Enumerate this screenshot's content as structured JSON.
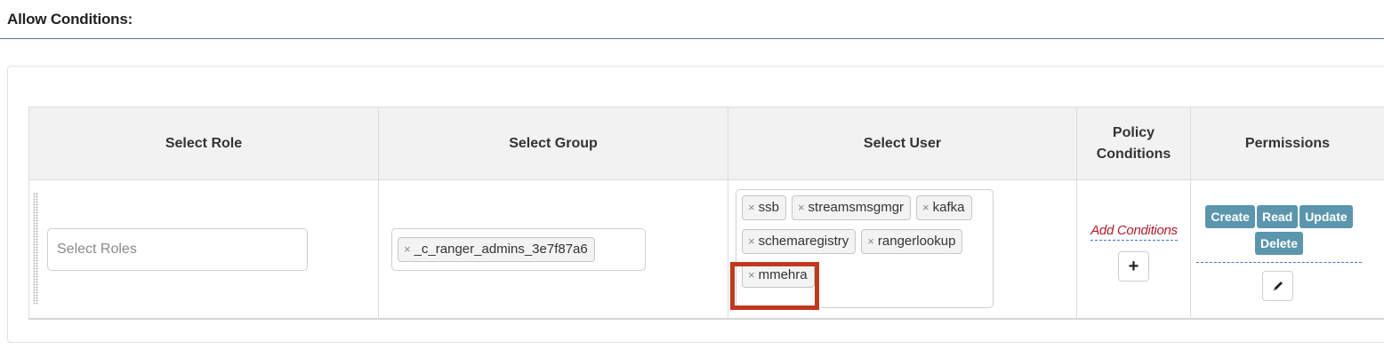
{
  "section": {
    "title": "Allow Conditions:"
  },
  "table": {
    "headers": {
      "role": "Select Role",
      "group": "Select Group",
      "user": "Select User",
      "policy_conditions": "Policy\nConditions",
      "permissions": "Permissions"
    },
    "row": {
      "roles_placeholder": "Select Roles",
      "groups": [
        "_c_ranger_admins_3e7f87a6"
      ],
      "users": [
        "ssb",
        "streamsmsgmgr",
        "kafka",
        "schemaregistry",
        "rangerlookup",
        "mmehra"
      ],
      "highlighted_user": "mmehra",
      "add_conditions_label": "Add Conditions",
      "add_button_icon": "plus-icon",
      "permissions": [
        "Create",
        "Read",
        "Update",
        "Delete"
      ],
      "edit_button_icon": "pencil-icon"
    }
  },
  "colors": {
    "permission_chip": "#5b96ad",
    "highlight_border": "#c0391e",
    "add_conditions_text": "#b11c2d"
  },
  "tag_remove_glyph": "×",
  "icons": {
    "plus": "+",
    "pencil": "✎"
  }
}
